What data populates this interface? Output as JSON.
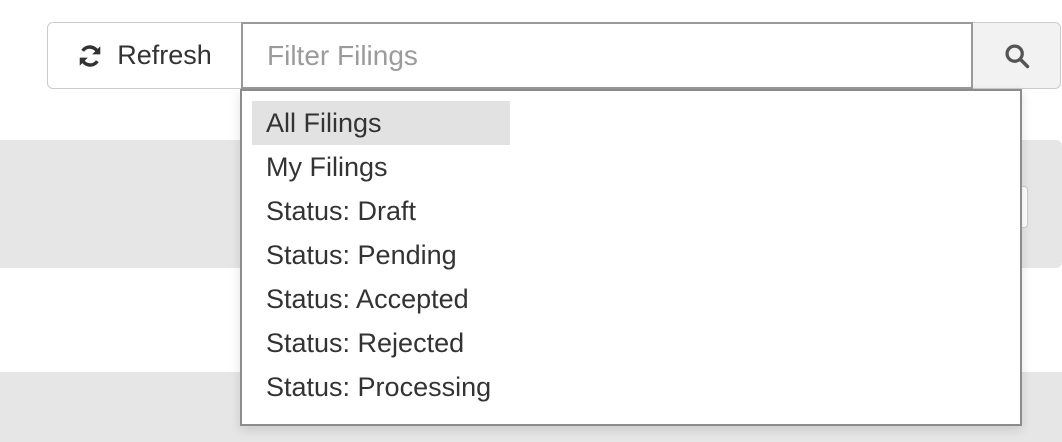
{
  "toolbar": {
    "refresh_label": "Refresh",
    "refresh_icon": "refresh-icon",
    "search_placeholder": "Filter Filings",
    "search_value": "",
    "search_icon": "search-icon"
  },
  "dropdown": {
    "selected": "All Filings",
    "items": [
      {
        "label": "All Filings"
      },
      {
        "label": "My Filings"
      },
      {
        "label": "Status: Draft"
      },
      {
        "label": "Status: Pending"
      },
      {
        "label": "Status: Accepted"
      },
      {
        "label": "Status: Rejected"
      },
      {
        "label": "Status: Processing"
      }
    ]
  },
  "colors": {
    "panel_background": "#e6e6e6",
    "selected_item_background": "#e2e2e2",
    "input_border": "#9a9a9a",
    "text": "#333333",
    "placeholder": "#9b9b9b"
  }
}
